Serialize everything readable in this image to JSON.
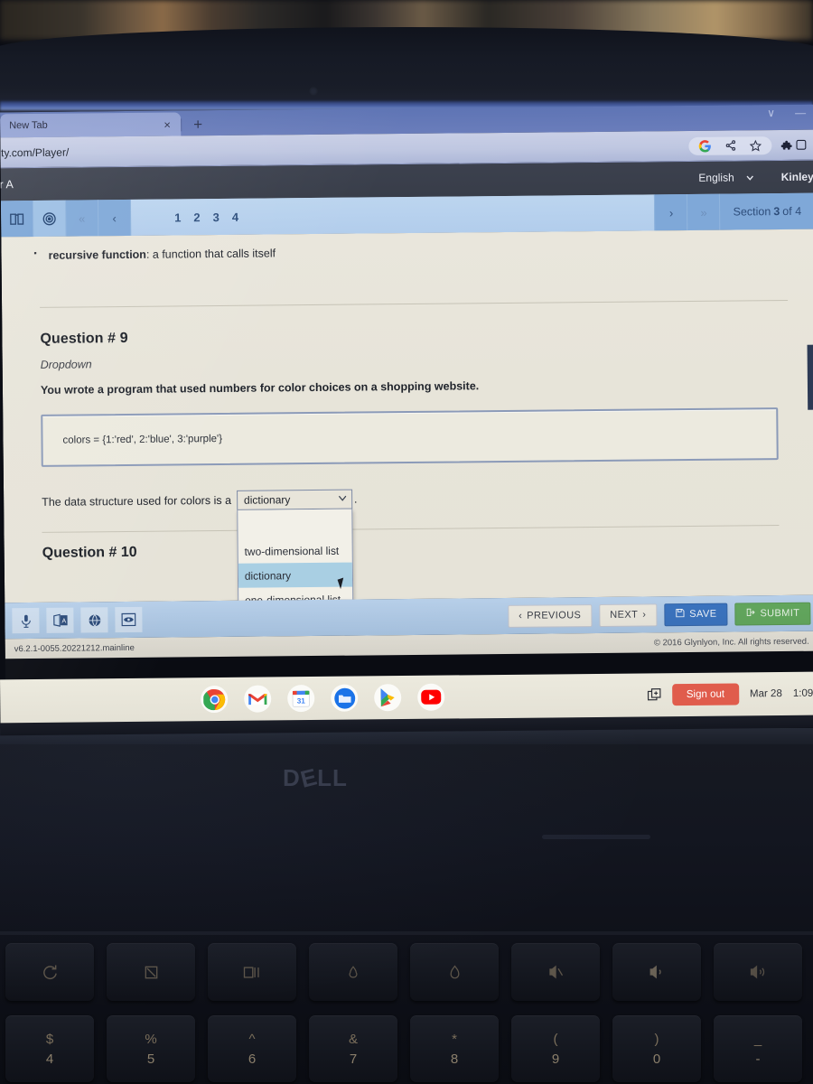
{
  "browser": {
    "tab_title": "New Tab",
    "close_label": "×",
    "newtab_label": "+",
    "url": "ity.com/Player/",
    "window_minimize": "—",
    "window_chevron": "∨"
  },
  "app_header": {
    "course": "ster A",
    "language": "English",
    "user": "Kinley"
  },
  "nav": {
    "first_label": "«",
    "prev_label": "‹",
    "pages": [
      "1",
      "2",
      "3",
      "4"
    ],
    "next_label": "›",
    "last_label": "»",
    "section_prefix": "Section",
    "section_current": "3",
    "section_suffix": "of 4"
  },
  "lesson": {
    "vocab_term": "recursive function",
    "vocab_def": ": a function that calls itself"
  },
  "question": {
    "title": "Question # 9",
    "type": "Dropdown",
    "prompt": "You wrote a program that used numbers for color choices on a shopping website.",
    "code": "colors = {1:'red', 2:'blue', 3:'purple'}",
    "answer_prefix": "The data structure used for colors is a",
    "answer_suffix": ".",
    "dropdown": {
      "selected": "dictionary",
      "caret": "∨",
      "options": [
        "",
        "two-dimensional list",
        "dictionary",
        "one-dimensional list"
      ],
      "highlighted": "dictionary"
    }
  },
  "next_question": {
    "title": "Question # 10"
  },
  "footer": {
    "tools": [
      "microphone-icon",
      "translate-icon",
      "globe-icon",
      "reader-icon"
    ],
    "previous_label": "PREVIOUS",
    "previous_caret": "‹",
    "next_label": "NEXT",
    "next_caret": "›",
    "save_label": "SAVE",
    "submit_label": "SUBMIT",
    "version": "v6.2.1-0055.20221212.mainline",
    "copyright": "© 2016 Glynlyon, Inc. All rights reserved."
  },
  "shelf": {
    "apps": [
      "chrome-icon",
      "gmail-icon",
      "calendar-icon",
      "files-icon",
      "play-store-icon",
      "youtube-icon"
    ],
    "calendar_day": "31",
    "screenshot_label": "screen-capture-icon",
    "sign_out_label": "Sign out",
    "date": "Mar 28",
    "time": "1:09"
  },
  "laptop": {
    "brand": "D∕LL",
    "brand_d": "D",
    "brand_e": "E",
    "brand_ll": "LL",
    "fn_keys": [
      "refresh-key",
      "fullscreen-key",
      "overview-key",
      "brightness-down-key",
      "brightness-up-key",
      "mute-key",
      "volume-down-key"
    ],
    "num_keys": [
      {
        "top": "$",
        "bot": "4"
      },
      {
        "top": "%",
        "bot": "5"
      },
      {
        "top": "^",
        "bot": "6"
      },
      {
        "top": "&",
        "bot": "7"
      },
      {
        "top": "*",
        "bot": "8"
      },
      {
        "top": "(",
        "bot": "9"
      },
      {
        "top": ")",
        "bot": "0"
      },
      {
        "top": "_",
        "bot": "-"
      }
    ]
  },
  "colors": {
    "accent_blue": "#3b74c0",
    "submit_green": "#63a85e",
    "signout_red": "#e05c4c",
    "nav_blue": "#a9c6e8",
    "header_dark": "#3c414e",
    "page_bg": "#e9e6dc"
  }
}
